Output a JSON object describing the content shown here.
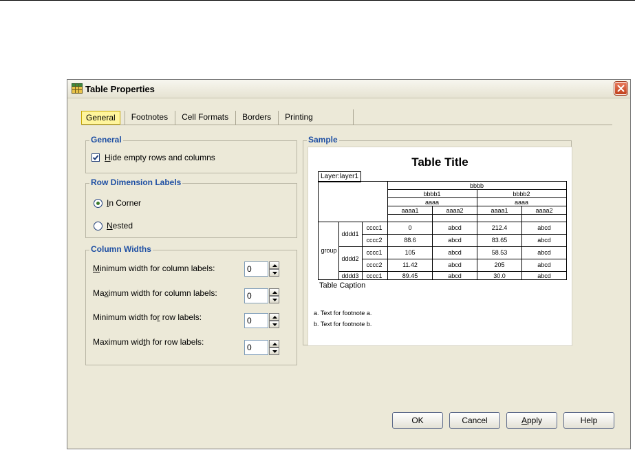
{
  "window": {
    "title": "Table Properties"
  },
  "tabs": [
    "General",
    "Footnotes",
    "Cell Formats",
    "Borders",
    "Printing"
  ],
  "general": {
    "legend": "General",
    "hide_empty": {
      "mn": "H",
      "rest": "ide empty rows and columns",
      "checked": true
    }
  },
  "row_dim": {
    "legend": "Row Dimension Labels",
    "options": [
      {
        "mn": "I",
        "rest": "n Corner",
        "selected": true
      },
      {
        "mn": "N",
        "rest": "ested",
        "selected": false
      }
    ]
  },
  "col_widths": {
    "legend": "Column Widths",
    "rows": [
      {
        "pre": "",
        "mn": "M",
        "post": "inimum width for column labels:",
        "value": "0"
      },
      {
        "pre": "Ma",
        "mn": "x",
        "post": "imum width for column labels:",
        "value": "0"
      },
      {
        "pre": "Minimum width fo",
        "mn": "r",
        "post": " row labels:",
        "value": "0"
      },
      {
        "pre": "Maximum wid",
        "mn": "t",
        "post": "h for row labels:",
        "value": "0"
      }
    ]
  },
  "sample": {
    "legend": "Sample",
    "table_title": "Table Title",
    "layer": "Layer:layer1",
    "headers": {
      "b": "bbbb",
      "b1": "bbbb1",
      "b2": "bbbb2",
      "a": "aaaa",
      "a1": "aaaa1",
      "a2": "aaaa2"
    },
    "group": "group",
    "rows": [
      {
        "d": "dddd1",
        "c": "cccc1",
        "v": [
          "0",
          "abcd",
          "212.4",
          "abcd"
        ]
      },
      {
        "d": "",
        "c": "cccc2",
        "v": [
          "88.6",
          "abcd",
          "83.65",
          "abcd"
        ]
      },
      {
        "d": "dddd2",
        "c": "cccc1",
        "v": [
          "105",
          "abcd",
          "58.53",
          "abcd"
        ]
      },
      {
        "d": "",
        "c": "cccc2",
        "v": [
          "11.42",
          "abcd",
          "205",
          "abcd"
        ]
      },
      {
        "d": "dddd3",
        "c": "cccc1",
        "v": [
          "89.45",
          "abcd",
          "30.0",
          "abcd"
        ]
      }
    ],
    "caption": "Table Caption",
    "footnotes": [
      "a. Text for footnote a.",
      "b. Text for footnote b."
    ]
  },
  "buttons": {
    "ok": "OK",
    "cancel": "Cancel",
    "apply_mn": "A",
    "apply_rest": "pply",
    "help": "Help"
  },
  "colors": {
    "legend": "#1e4fa3",
    "active_tab": "#fff59c",
    "dialog_bg": "#ece9d8"
  }
}
